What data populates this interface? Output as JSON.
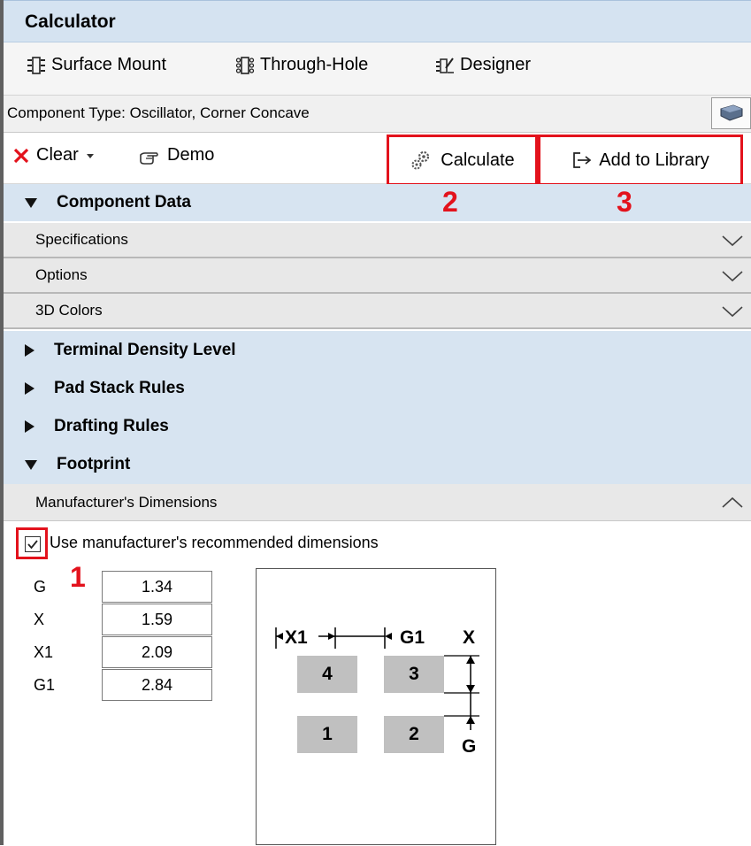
{
  "panel": {
    "title": "Calculator"
  },
  "modes": [
    {
      "label": "Surface Mount",
      "icon": "smd-component-icon"
    },
    {
      "label": "Through-Hole",
      "icon": "through-hole-component-icon"
    },
    {
      "label": "Designer",
      "icon": "designer-icon"
    }
  ],
  "component_type": "Component Type: Oscillator, Corner Concave",
  "toolbar": {
    "clear_label": "Clear",
    "demo_label": "Demo",
    "calculate_label": "Calculate",
    "add_label": "Add to Library"
  },
  "sections": {
    "component_data": "Component Data",
    "specifications": "Specifications",
    "options": "Options",
    "colors_3d": "3D Colors",
    "terminal_density": "Terminal Density Level",
    "pad_stack": "Pad Stack Rules",
    "drafting": "Drafting Rules",
    "footprint": "Footprint",
    "manufacturer_dims": "Manufacturer's Dimensions"
  },
  "annotations": {
    "step1": "1",
    "step2": "2",
    "step3": "3"
  },
  "use_manufacturer": {
    "checked": true,
    "label": "Use manufacturer's recommended dimensions"
  },
  "dimensions": [
    {
      "label": "G",
      "value": "1.34"
    },
    {
      "label": "X",
      "value": "1.59"
    },
    {
      "label": "X1",
      "value": "2.09"
    },
    {
      "label": "G1",
      "value": "2.84"
    }
  ],
  "diagram": {
    "pads": [
      "4",
      "3",
      "1",
      "2"
    ],
    "x1_label": "X1",
    "g1_label": "G1",
    "x_label": "X",
    "g_label": "G"
  },
  "colors": {
    "accent_red": "#e3121c",
    "section_blue": "#d7e4f1"
  }
}
